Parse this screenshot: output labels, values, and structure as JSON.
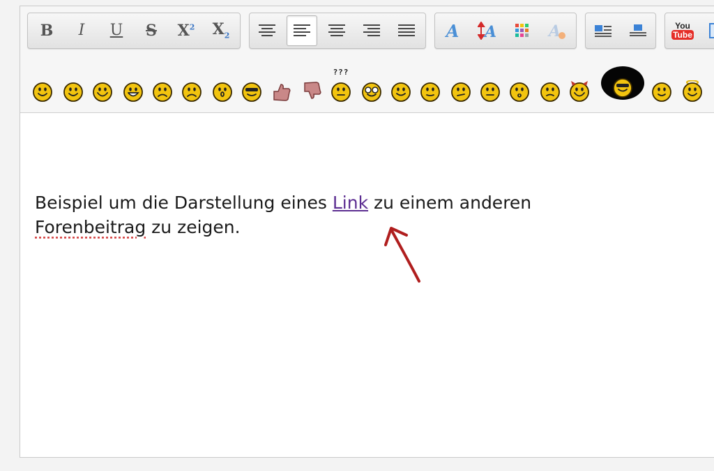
{
  "toolbar": {
    "formatting": [
      {
        "id": "bold",
        "label": "B"
      },
      {
        "id": "italic",
        "label": "I"
      },
      {
        "id": "underline",
        "label": "U"
      },
      {
        "id": "strike",
        "label": "S"
      },
      {
        "id": "superscript",
        "label": "X",
        "mark": "2"
      },
      {
        "id": "subscript",
        "label": "X",
        "mark": "2"
      }
    ],
    "alignment": [
      "align-left-icon",
      "align-justify-icon",
      "align-center-icon",
      "align-right-icon",
      "align-full-icon"
    ],
    "alignment_active": "align-justify-icon",
    "font": [
      "font-icon",
      "font-size-icon",
      "color-palette-icon",
      "remove-format-icon"
    ],
    "layout": [
      "block-left-icon",
      "block-top-icon"
    ],
    "media": {
      "youtube_top": "You",
      "youtube_bottom": "Tube"
    }
  },
  "smileys": [
    "smile",
    "wink",
    "happy",
    "grin",
    "angry",
    "sad",
    "surprised",
    "cool",
    "thumbs-up",
    "thumbs-down",
    "confused",
    "nerd",
    "tongue",
    "blush",
    "unsure",
    "rolleyes",
    "kiss",
    "worried",
    "devil",
    "afro",
    "smile-small",
    "angel"
  ],
  "smiley_question_marks": "???",
  "content": {
    "text_before_link": "Beispiel um die Darstellung eines ",
    "link_text": "Link",
    "text_after_link": " zu einem anderen ",
    "misspelled_word": "Forenbeitrag",
    "text_end": " zu zeigen."
  },
  "colors": {
    "link": "#5c2d91",
    "annotation_arrow": "#b01e1e",
    "spellcheck": "#d43c3c",
    "smiley_fill": "#f2c40f"
  }
}
